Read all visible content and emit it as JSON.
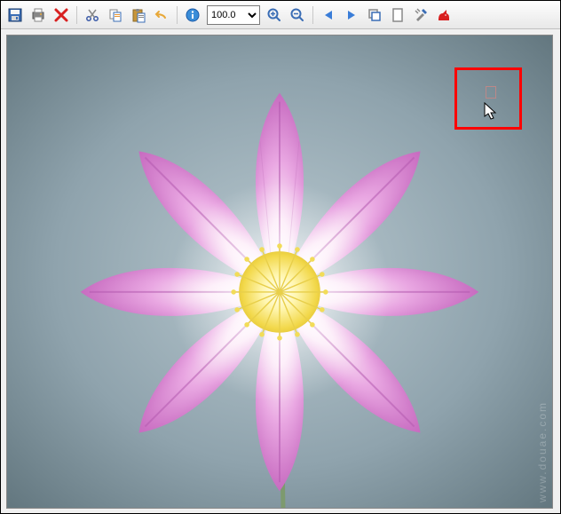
{
  "toolbar": {
    "save_label": "Save",
    "print_label": "Print",
    "delete_label": "Delete",
    "cut_label": "Cut",
    "copy_label": "Copy",
    "paste_label": "Paste",
    "undo_label": "Undo",
    "info_label": "Info",
    "zoom_value": "100.0",
    "zoom_in_label": "Zoom In",
    "zoom_out_label": "Zoom Out",
    "prev_label": "Previous",
    "next_label": "Next",
    "window_label": "Window",
    "page_label": "Page",
    "settings_label": "Settings",
    "irfan_label": "IrfanView"
  },
  "canvas": {
    "subject": "flower-image",
    "highlight_color": "#ff0000"
  },
  "watermark": "www.douae.com"
}
